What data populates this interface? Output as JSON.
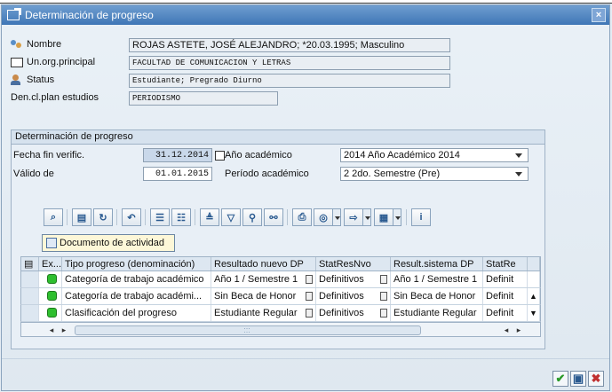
{
  "window": {
    "title": "Determinación de progreso",
    "close_label": "×"
  },
  "header_fields": {
    "nombre_label": "Nombre",
    "nombre_value": "ROJAS ASTETE, JOSÉ ALEJANDRO; *20.03.1995; Masculino",
    "unorg_label": "Un.org.principal",
    "unorg_value": "FACULTAD DE COMUNICACION Y LETRAS",
    "status_label": "Status",
    "status_value": "Estudiante; Pregrado Diurno",
    "plan_label": "Den.cl.plan estudios",
    "plan_value": "PERIODISMO"
  },
  "group": {
    "title": "Determinación de progreso",
    "fecha_label": "Fecha fin verific.",
    "fecha_value": "31.12.2014",
    "valido_label": "Válido de",
    "valido_value": "01.01.2015",
    "anio_label": "Año académico",
    "anio_value": "2014 Año Académico 2014",
    "periodo_label": "Período académico",
    "periodo_value": "2 2do. Semestre (Pre)"
  },
  "toolbar": {
    "icons": [
      "details-icon",
      "folder-icon",
      "refresh-icon",
      "undo-icon",
      "select-all-icon",
      "deselect-all-icon",
      "sort-asc-icon",
      "filter-icon",
      "find-icon",
      "find-next-icon",
      "print-icon",
      "view-icon",
      "export-icon",
      "layout-icon",
      "info-icon"
    ],
    "info_glyph": "i"
  },
  "doc_button": {
    "label": "Documento de actividad"
  },
  "table": {
    "columns": [
      "Ex...",
      "Tipo progreso (denominación)",
      "Resultado nuevo DP",
      "StatResNvo",
      "Result.sistema DP",
      "StatRe"
    ],
    "rows": [
      {
        "tipo": "Categoría de trabajo académico",
        "resultado": "Año 1 / Semestre 1",
        "stat": "Definitivos",
        "sistema": "Año 1 / Semestre 1",
        "statre": "Definit"
      },
      {
        "tipo": "Categoría de trabajo académi...",
        "resultado": "Sin Beca de Honor",
        "stat": "Definitivos",
        "sistema": "Sin Beca de Honor",
        "statre": "Definit"
      },
      {
        "tipo": "Clasificación del progreso",
        "resultado": "Estudiante Regular",
        "stat": "Definitivos",
        "sistema": "Estudiante Regular",
        "statre": "Definit"
      }
    ],
    "scroll_left": "◂",
    "scroll_right": "▸",
    "scroll_up": "▲",
    "scroll_down": "▼",
    "scroll_grip": ":::"
  },
  "footer": {
    "ok_glyph": "✔",
    "save_glyph": "▣",
    "cancel_glyph": "✖"
  },
  "colors": {
    "titlebar": "#3f76b6",
    "led_green": "#2fbf2f",
    "ok_green": "#2a9a2a",
    "cancel_red": "#c03030"
  }
}
